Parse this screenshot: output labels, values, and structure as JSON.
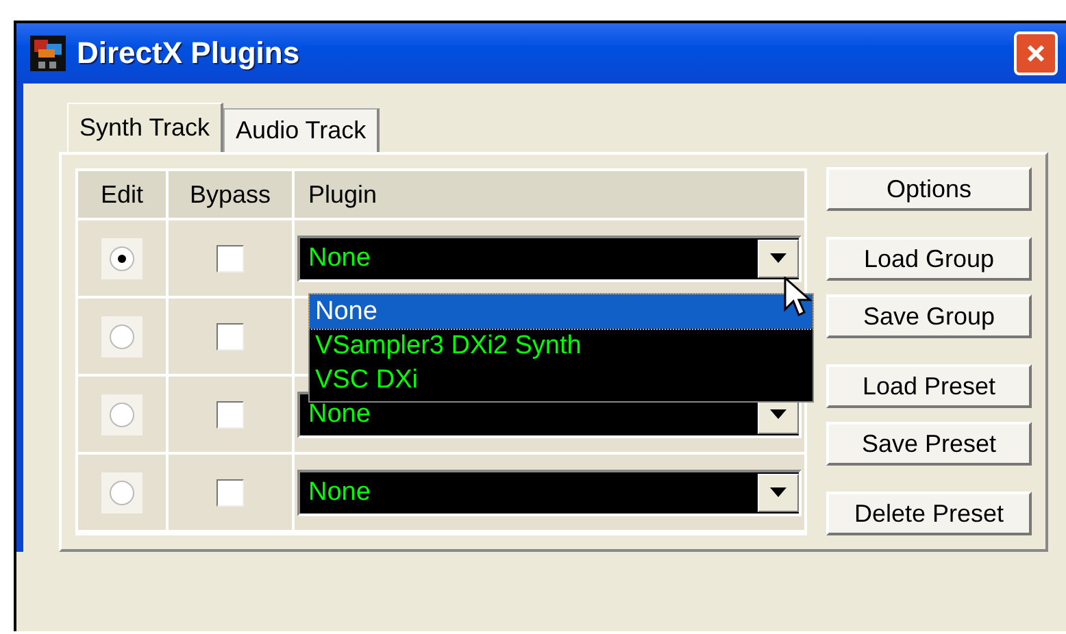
{
  "window": {
    "title": "DirectX Plugins"
  },
  "tabs": [
    {
      "label": "Synth Track",
      "selected": true
    },
    {
      "label": "Audio Track",
      "selected": false
    }
  ],
  "table": {
    "columns": [
      "Edit",
      "Bypass",
      "Plugin"
    ],
    "rows": [
      {
        "edit": true,
        "bypass": false,
        "plugin": "None"
      },
      {
        "edit": false,
        "bypass": false
      },
      {
        "edit": false,
        "bypass": false,
        "plugin": "None"
      },
      {
        "edit": false,
        "bypass": false,
        "plugin": "None"
      }
    ]
  },
  "dropdown": {
    "items": [
      {
        "label": "None",
        "selected": true
      },
      {
        "label": "VSampler3 DXi2 Synth",
        "selected": false
      },
      {
        "label": "VSC DXi",
        "selected": false
      }
    ]
  },
  "buttons": [
    "Options",
    "Load Group",
    "Save Group",
    "Load Preset",
    "Save Preset",
    "Delete Preset"
  ]
}
